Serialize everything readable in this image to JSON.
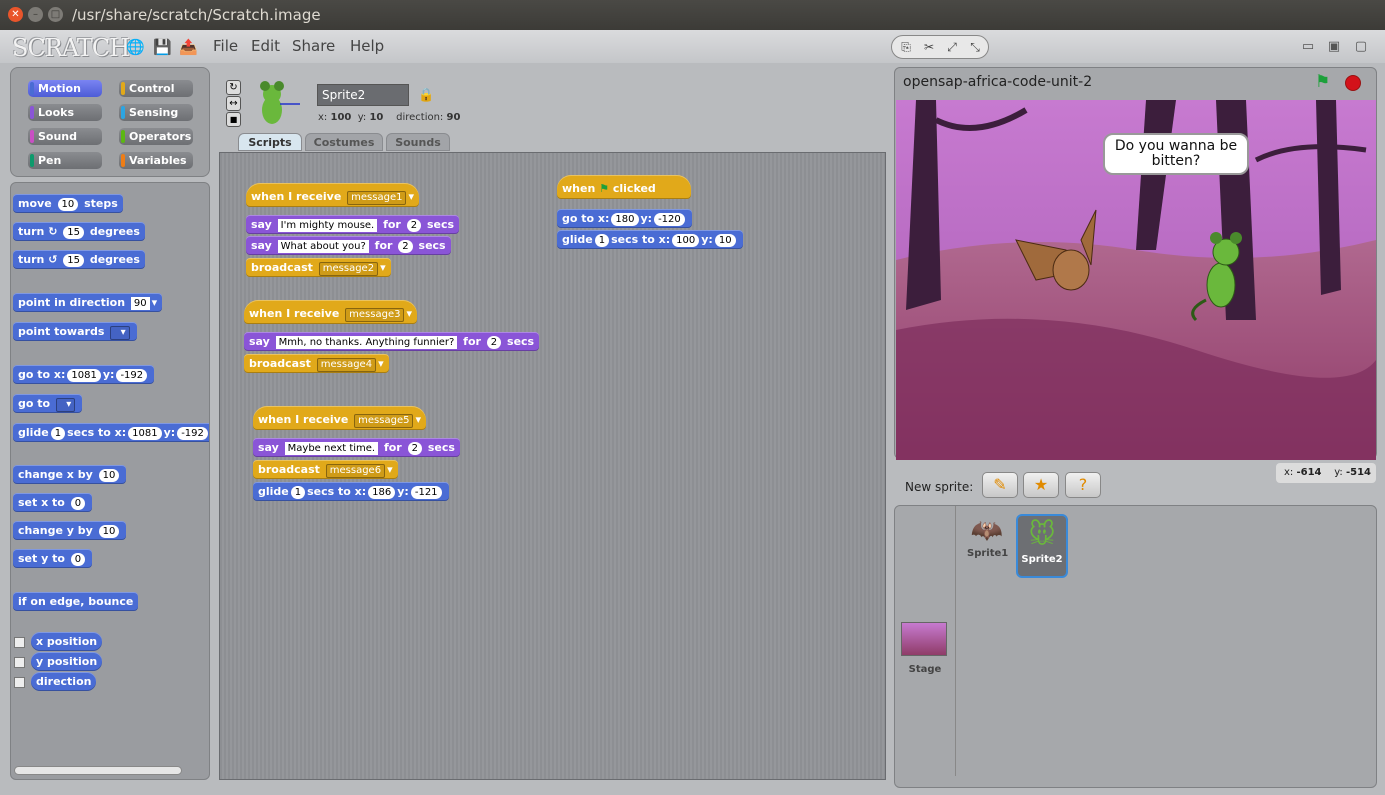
{
  "window": {
    "title": "/usr/share/scratch/Scratch.image"
  },
  "menu": {
    "logo": "SCRATCH",
    "file": "File",
    "edit": "Edit",
    "share": "Share",
    "help": "Help"
  },
  "categories": [
    "Motion",
    "Control",
    "Looks",
    "Sensing",
    "Sound",
    "Operators",
    "Pen",
    "Variables"
  ],
  "palette": {
    "move": "move",
    "move_n": "10",
    "steps": "steps",
    "turn": "turn",
    "turn_n": "15",
    "degrees": "degrees",
    "point_dir": "point in direction",
    "point_dir_v": "90",
    "point_towards": "point towards",
    "goto_x": "go to x:",
    "goto_xv": "1081",
    "y": "y:",
    "goto_yv": "-192",
    "goto": "go to",
    "glide": "glide",
    "glide_n": "1",
    "secs_to_x": "secs to x:",
    "glide_x": "1081",
    "glide_y": "-192",
    "change_x": "change x by",
    "change_x_v": "10",
    "set_x": "set x to",
    "set_x_v": "0",
    "change_y": "change y by",
    "change_y_v": "10",
    "set_y": "set y to",
    "set_y_v": "0",
    "bounce": "if on edge, bounce",
    "xpos": "x position",
    "ypos": "y position",
    "direction": "direction"
  },
  "sprite": {
    "name": "Sprite2",
    "x_label": "x:",
    "x": "100",
    "y_label": "y:",
    "y": "10",
    "dir_label": "direction:",
    "dir": "90"
  },
  "tabs": [
    "Scripts",
    "Costumes",
    "Sounds"
  ],
  "scripts": {
    "when_receive": "when I receive",
    "say": "say",
    "for": "for",
    "secs": "secs",
    "broadcast": "broadcast",
    "msg1": "message1",
    "say1": "I'm mighty mouse.",
    "t1": "2",
    "say2": "What about you?",
    "t2": "2",
    "msg2": "message2",
    "msg3": "message3",
    "say3": "Mmh, no thanks. Anything funnier?",
    "t3": "2",
    "msg4": "message4",
    "msg5": "message5",
    "say4": "Maybe next time.",
    "t4": "2",
    "msg6": "message6",
    "glide": "glide",
    "g_n": "1",
    "g_to": "secs to x:",
    "g_x": "186",
    "g_y_label": "y:",
    "g_y": "-121",
    "when": "when",
    "clicked": "clicked",
    "goto": "go to x:",
    "goto_x": "180",
    "goto_y": "-120",
    "glide2_n": "1",
    "glide2_x": "100",
    "glide2_y": "10"
  },
  "stage": {
    "project": "opensap-africa-code-unit-2",
    "speech": "Do you wanna be bitten?",
    "mouse_x_label": "x:",
    "mouse_x": "-614",
    "mouse_y_label": "y:",
    "mouse_y": "-514"
  },
  "sprites": {
    "new_sprite": "New sprite:",
    "list": [
      "Sprite1",
      "Sprite2"
    ],
    "stage": "Stage"
  },
  "colors": {
    "motion": "#4a6cd4",
    "looks": "#8a55d7",
    "control": "#e1a91a",
    "sound": "#c94fc4",
    "pen": "#0e9a6c",
    "sensing": "#2ca5e2",
    "operators": "#5cb712",
    "variables": "#ee7d16"
  }
}
